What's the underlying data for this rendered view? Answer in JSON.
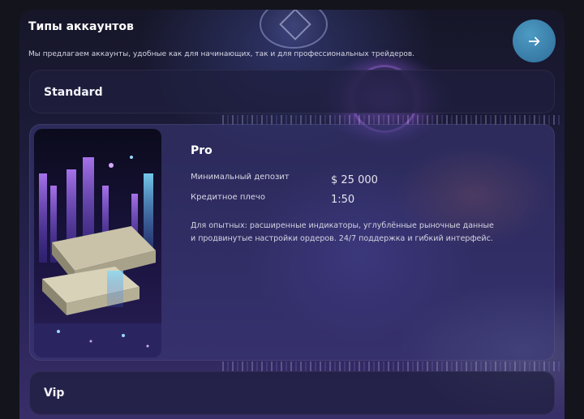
{
  "section": {
    "title": "Типы аккаунтов",
    "subtitle": "Мы предлагаем аккаунты, удобные как для начинающих, так и для профессиональных трейдеров."
  },
  "next_button": {
    "icon": "arrow-right-icon"
  },
  "accounts": {
    "standard": {
      "label": "Standard"
    },
    "pro": {
      "label": "Pro",
      "min_deposit_label": "Минимальный депозит",
      "min_deposit_value": "$ 25 000",
      "leverage_label": "Кредитное плечо",
      "leverage_value": "1:50",
      "description": "Для опытных: расширенные индикаторы, углублённые рыночные данные и продвинутые настройки ордеров. 24/7 поддержка и гибкий интерфейс."
    },
    "vip": {
      "label": "Vip"
    }
  },
  "colors": {
    "accent": "#3a86b3",
    "card": "#3a3878",
    "background": "#14141d"
  }
}
